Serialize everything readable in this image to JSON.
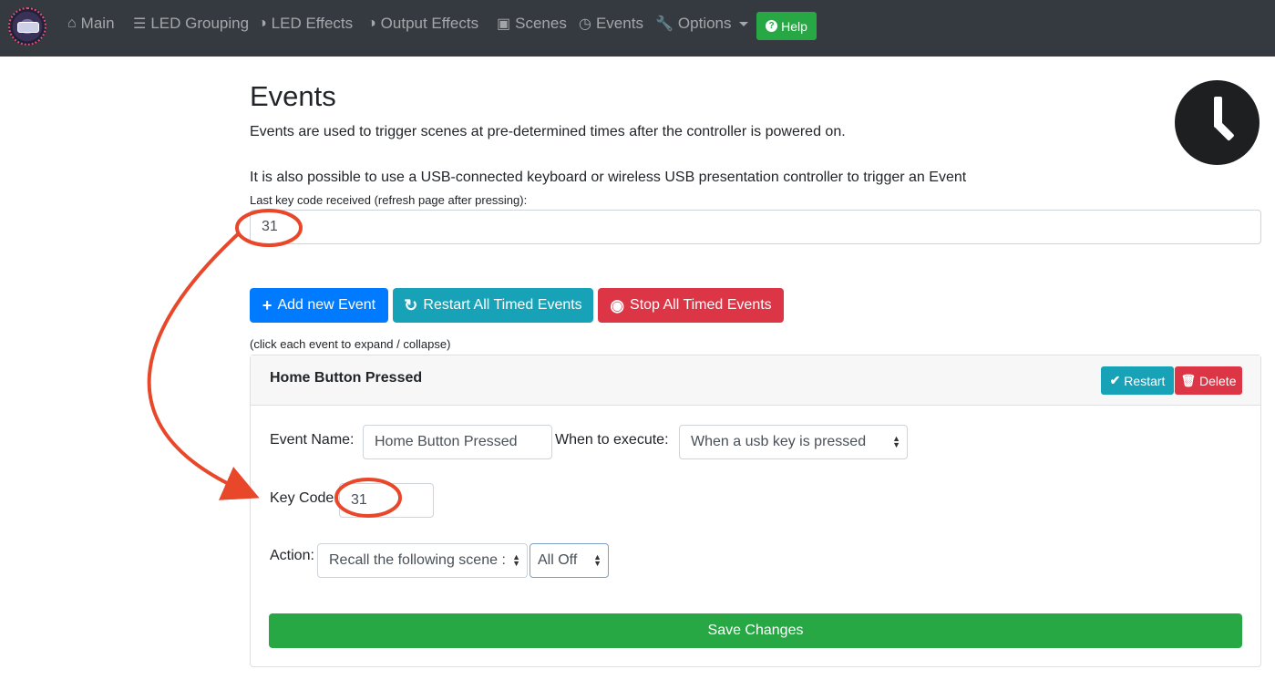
{
  "nav": {
    "items": [
      {
        "label": "Main",
        "icon": "home-icon"
      },
      {
        "label": "LED Grouping",
        "icon": "layers-icon"
      },
      {
        "label": "LED Effects",
        "icon": "half-circle-icon"
      },
      {
        "label": "Output Effects",
        "icon": "half-circle-icon"
      },
      {
        "label": "Scenes",
        "icon": "image-icon"
      },
      {
        "label": "Events",
        "icon": "clock-icon"
      },
      {
        "label": "Options",
        "icon": "wrench-icon"
      }
    ],
    "help_label": "Help"
  },
  "page": {
    "title": "Events",
    "intro": "Events are used to trigger scenes at pre-determined times after the controller is powered on.",
    "intro2": "It is also possible to use a USB-connected keyboard or wireless USB presentation controller to trigger an Event",
    "key_code_label": "Last key code received (refresh page after pressing):",
    "key_code_value": "31"
  },
  "actions": {
    "add": "Add new Event",
    "restart_all": "Restart All Timed Events",
    "stop_all": "Stop All Timed Events",
    "hint": "(click each event to expand / collapse)"
  },
  "event": {
    "title": "Home Button Pressed",
    "restart": "Restart",
    "delete": "Delete",
    "name_label": "Event Name:",
    "name_value": "Home Button Pressed",
    "when_label": "When to execute:",
    "when_value": "When a usb key is pressed",
    "key_label": "Key Code:",
    "key_value": "31",
    "action_label": "Action:",
    "action_value": "Recall the following scene :",
    "scene_value": "All Off",
    "save": "Save Changes"
  },
  "colors": {
    "navbar": "#343a40",
    "primary": "#007bff",
    "info": "#17a2b8",
    "danger": "#dc3545",
    "success": "#28a745",
    "annotation": "#e8472a"
  }
}
